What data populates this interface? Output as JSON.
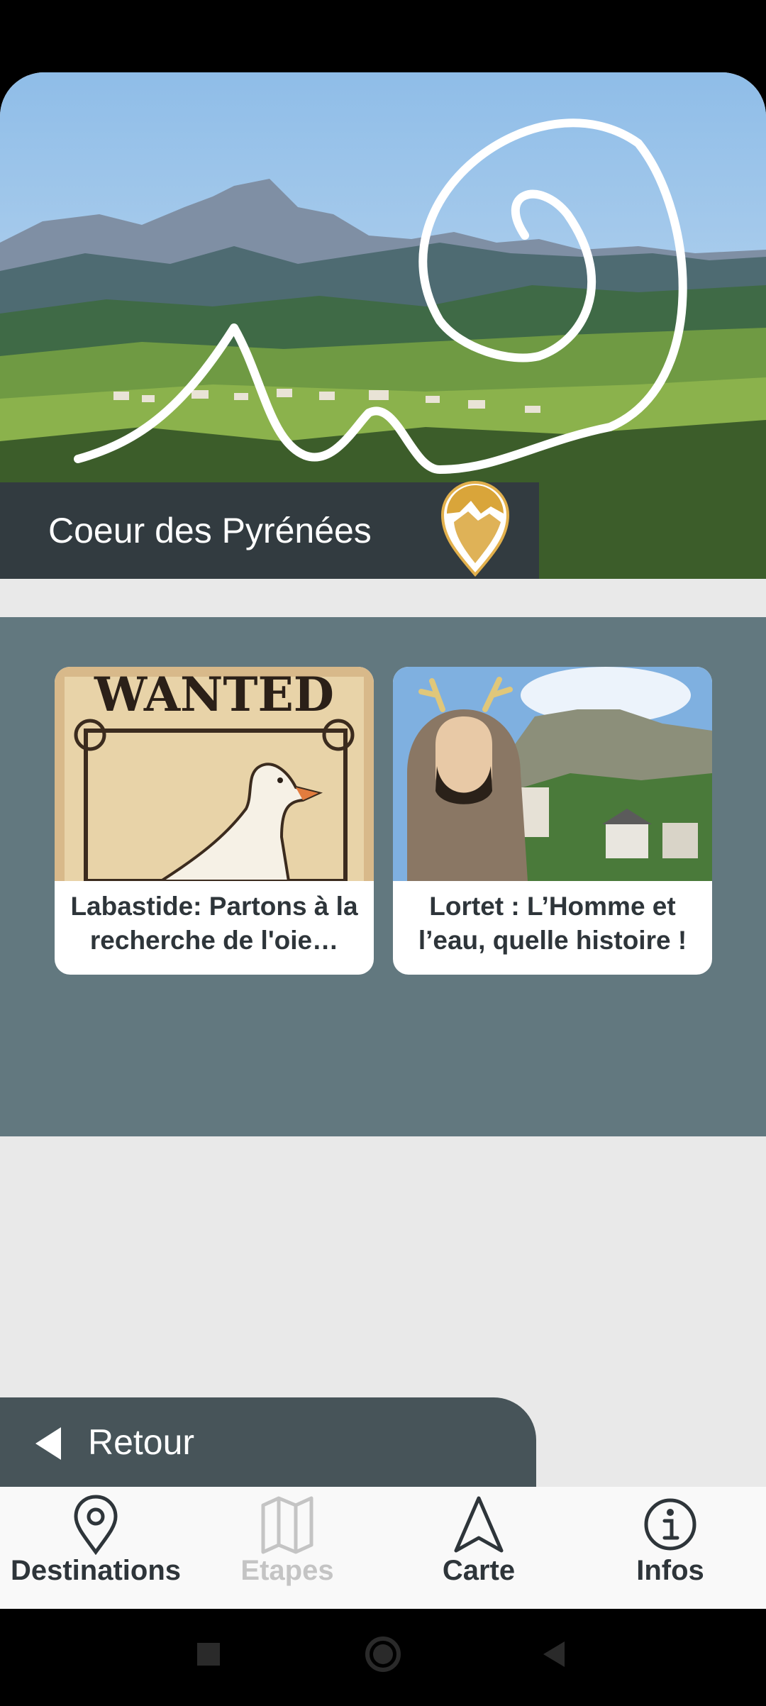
{
  "app": {
    "region_title": "Coeur des Pyrénées"
  },
  "cards": [
    {
      "title": "Labastide: Partons à la recherche de l'oie…",
      "image_text": "WANTED"
    },
    {
      "title": "Lortet : L’Homme et l’eau, quelle histoire !"
    }
  ],
  "back": {
    "label": "Retour"
  },
  "nav": {
    "items": [
      {
        "label": "Destinations",
        "icon": "map-pin-icon",
        "enabled": true
      },
      {
        "label": "Etapes",
        "icon": "map-icon",
        "enabled": false
      },
      {
        "label": "Carte",
        "icon": "navigation-arrow-icon",
        "enabled": true
      },
      {
        "label": "Infos",
        "icon": "info-icon",
        "enabled": true
      }
    ]
  },
  "colors": {
    "dark_slate": "#323b40",
    "panel": "#62787f",
    "back_tab": "#475459",
    "text_dark": "#2e353a",
    "disabled": "#c4c4c4",
    "logo_gold": "#d9a53a"
  }
}
